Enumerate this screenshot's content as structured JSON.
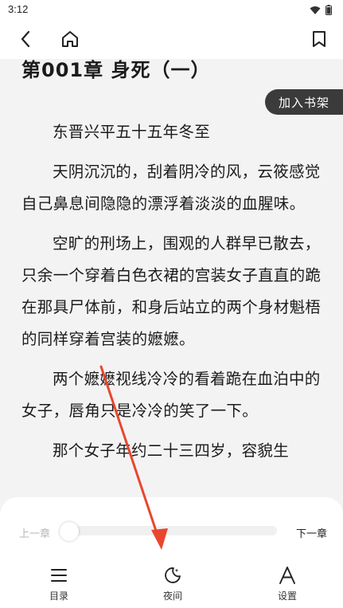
{
  "status_bar": {
    "time": "3:12"
  },
  "chapter": {
    "title": "第001章 身死（一）"
  },
  "bookmark": {
    "label": "加入书架"
  },
  "paragraphs": [
    "东晋兴平五十五年冬至",
    "天阴沉沉的，刮着阴冷的风，云筱感觉自己鼻息间隐隐的漂浮着淡淡的血腥味。",
    "空旷的刑场上，围观的人群早已散去，只余一个穿着白色衣裙的宫装女子直直的跪在那具尸体前，和身后站立的两个身材魁梧的同样穿着宫装的嬷嬷。",
    "两个嬷嬷视线冷冷的看着跪在血泊中的女子，唇角只是冷冷的笑了一下。",
    "那个女子年约二十三四岁，容貌生"
  ],
  "reader_panel": {
    "prev_chapter": "上一章",
    "next_chapter": "下一章",
    "progress": 0.0,
    "nav": [
      {
        "label": "目录",
        "icon": "menu-icon"
      },
      {
        "label": "夜间",
        "icon": "moon-icon"
      },
      {
        "label": "设置",
        "icon": "font-icon"
      }
    ]
  },
  "colors": {
    "annotation_arrow": "#e8472e",
    "bookmark_bg": "#3b3b3b"
  }
}
